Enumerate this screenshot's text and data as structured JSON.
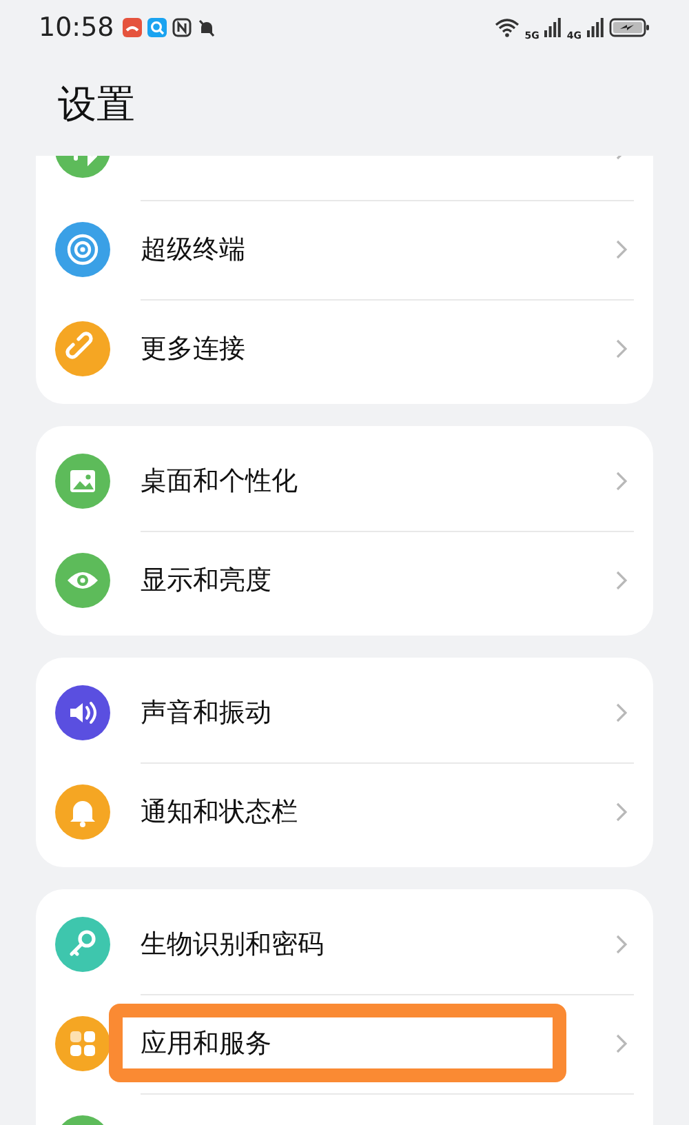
{
  "status_bar": {
    "time": "10:58",
    "network_labels": [
      "5G",
      "4G"
    ]
  },
  "title": "设置",
  "cards": [
    {
      "items": [
        {
          "kind": "network",
          "highlighted": false
        },
        {
          "label": "超级终端",
          "kind": "terminal",
          "highlighted": false
        },
        {
          "label": "更多连接",
          "kind": "link",
          "highlighted": false
        }
      ]
    },
    {
      "items": [
        {
          "label": "桌面和个性化",
          "kind": "image",
          "highlighted": false
        },
        {
          "label": "显示和亮度",
          "kind": "eye",
          "highlighted": false
        }
      ]
    },
    {
      "items": [
        {
          "label": "声音和振动",
          "kind": "speaker",
          "highlighted": false
        },
        {
          "label": "通知和状态栏",
          "kind": "bell",
          "highlighted": false
        }
      ]
    },
    {
      "items": [
        {
          "label": "生物识别和密码",
          "kind": "key",
          "highlighted": false
        },
        {
          "label": "应用和服务",
          "kind": "grid",
          "highlighted": true
        },
        {
          "kind": "blank",
          "highlighted": false
        }
      ]
    }
  ]
}
